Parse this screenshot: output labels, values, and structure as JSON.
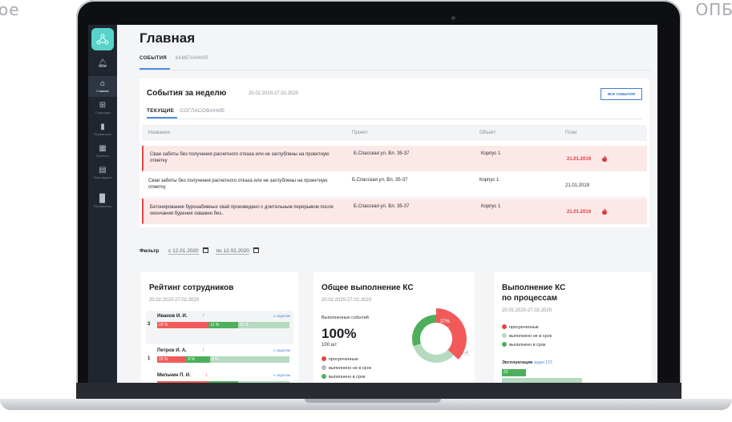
{
  "corner_left": "ое",
  "corner_right": "ОПБ",
  "colors": {
    "accent": "#4a8de3",
    "danger": "#e64545",
    "success": "#4caf5c",
    "muted": "#b5dac0",
    "sidebar": "#1f2630",
    "logo": "#57d3c9"
  },
  "sidebar": {
    "items": [
      {
        "icon": "bell-icon",
        "label": ""
      },
      {
        "icon": "home-icon",
        "label": "Главная"
      },
      {
        "icon": "structure-icon",
        "label": "Структура"
      },
      {
        "icon": "chart-icon",
        "label": "Показатели"
      },
      {
        "icon": "buildings-icon",
        "label": "Проекты"
      },
      {
        "icon": "clipboard-icon",
        "label": "Мои задачи"
      },
      {
        "icon": "document-icon",
        "label": "Регламенты"
      }
    ]
  },
  "page": {
    "title": "Главная",
    "tabs": [
      "СОБЫТИЯ",
      "ЗАМЕЧАНИЯ"
    ]
  },
  "events": {
    "title": "События за неделю",
    "dates": "20.02.2020-27.02.2020",
    "all_button": "ВСЕ СОБЫТИЯ",
    "tabs": [
      "ТЕКУЩИЕ",
      "СОГЛАСОВАНИЕ"
    ],
    "columns": [
      "Название",
      "Проект",
      "Объект",
      "План"
    ],
    "rows": [
      {
        "name": "Сваи забиты без получения расчетного отказа или не заглублены на проектную отметку",
        "project": "Б.Спасская ул. Вл. 35-37",
        "object": "Корпус 1",
        "plan": "21.01.2019",
        "overdue": true
      },
      {
        "name": "Сваи забиты без получения расчетного отказа или не заглублены на проектную отметку",
        "project": "Б.Спасская ул. Вл. 35-37",
        "object": "Корпус 1",
        "plan": "21.01.2019",
        "overdue": false
      },
      {
        "name": "Бетонирование буронабивных свай произведено с длительным перерывом после окончания бурения скважин без..",
        "project": "Б.Спасская ул. Вл. 35-37",
        "object": "Корпус 1",
        "plan": "21.01.2019",
        "overdue": true
      }
    ]
  },
  "filter": {
    "label": "Фильтр",
    "from": "с 12.01.2020",
    "to": "по 12.02.2020"
  },
  "rating": {
    "title": "Рейтинг сотрудников",
    "dates": "20.02.2020-27.02.2020",
    "link": "к задачам",
    "people": [
      {
        "name": "Иванов И. И.",
        "rank": "3",
        "trend": "up",
        "segments": [
          {
            "label": "23 %",
            "value": 23
          },
          {
            "label": "11 %",
            "value": 11
          },
          {
            "label": "15 %",
            "value": 15
          }
        ]
      },
      {
        "name": "Петров И. А.",
        "rank": "1",
        "trend": "up",
        "segments": [
          {
            "label": "23 %",
            "value": 23
          },
          {
            "label": "9 %",
            "value": 9
          },
          {
            "label": "9 %",
            "value": 9
          }
        ]
      },
      {
        "name": "Мильчин П. И.",
        "rank": "",
        "trend": "down",
        "segments": [
          {
            "label": "",
            "value": 23
          },
          {
            "label": "",
            "value": 11
          },
          {
            "label": "",
            "value": 15
          }
        ]
      }
    ]
  },
  "ks": {
    "title": "Общее выполнение КС",
    "dates": "20.02.2020-27.02.2020",
    "events_label": "Выполненных событий",
    "percent": "100%",
    "count": "100 шт",
    "legend": [
      "просроченные",
      "выполнено не в срок",
      "выполнено в срок"
    ],
    "donut": {
      "segments": [
        {
          "value": 37,
          "color": "#f25a5a"
        },
        {
          "value": 33,
          "color": "#b5dac0"
        },
        {
          "value": 30,
          "color": "#4caf5c"
        }
      ],
      "label_pct": "37%",
      "label_cnt": "37шт."
    }
  },
  "kp": {
    "title_line1": "Выполнение КС",
    "title_line2": "по процессам",
    "dates": "20.02.2020-27.02.2020",
    "legend": [
      "просроченные",
      "выполнено не в срок",
      "выполнено в срок"
    ],
    "process": {
      "name": "Эксплуатация",
      "tasks": "задач 123",
      "value": "23"
    }
  }
}
